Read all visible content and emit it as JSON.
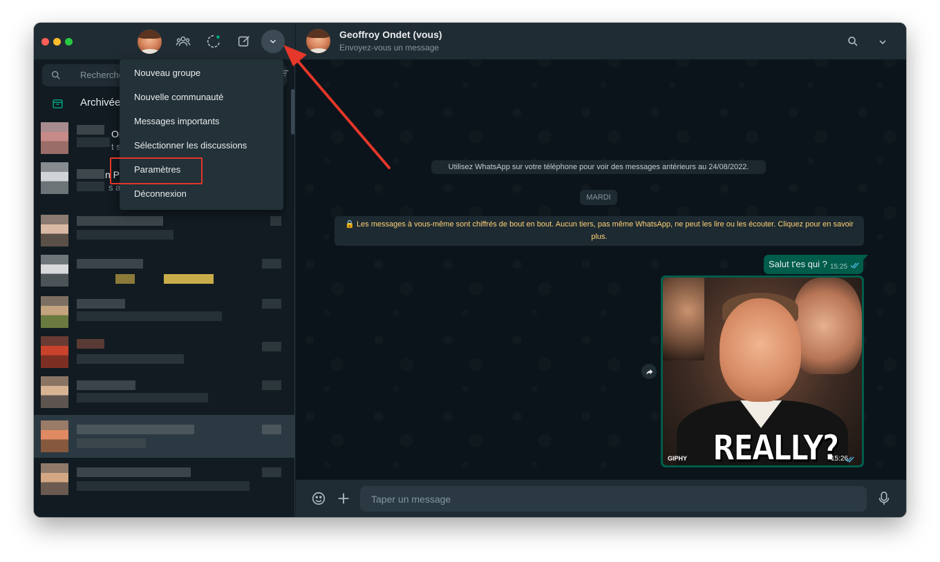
{
  "sidebar": {
    "search_placeholder": "Recherche",
    "archived_label": "Archivées",
    "peek": [
      {
        "title": "Or",
        "sub": "t s"
      },
      {
        "title": "n P",
        "sub": "s a"
      }
    ]
  },
  "menu": {
    "items": [
      "Nouveau groupe",
      "Nouvelle communauté",
      "Messages importants",
      "Sélectionner les discussions",
      "Paramètres",
      "Déconnexion"
    ],
    "highlighted": "Paramètres"
  },
  "conversation": {
    "contact_name": "Geoffroy Ondet (vous)",
    "contact_subtitle": "Envoyez-vous un message",
    "system_message": "Utilisez WhatsApp sur votre téléphone pour voir des messages antérieurs au 24/08/2022.",
    "day_label": "MARDI",
    "encryption_notice": "🔒 Les messages à vous-même sont chiffrés de bout en bout. Aucun tiers, pas même WhatsApp, ne peut les lire ou les écouter. Cliquez pour en savoir plus.",
    "messages": [
      {
        "type": "text",
        "text": "Salut t'es qui ?",
        "time": "15:25"
      },
      {
        "type": "gif",
        "caption_in_image": "REALLY?",
        "source": "GIPHY",
        "time": "15:26"
      }
    ],
    "input_placeholder": "Taper un message"
  },
  "colors": {
    "accent_green": "#00a884",
    "outgoing_bubble": "#005c4b",
    "annotation_red": "#e5372a",
    "encryption_text": "#ffd279"
  },
  "icons": [
    "search-icon",
    "community-icon",
    "status-icon",
    "new-chat-icon",
    "chevron-down-icon",
    "archive-icon",
    "filter-icon",
    "emoji-icon",
    "plus-icon",
    "mic-icon",
    "forward-icon",
    "double-check-icon"
  ]
}
